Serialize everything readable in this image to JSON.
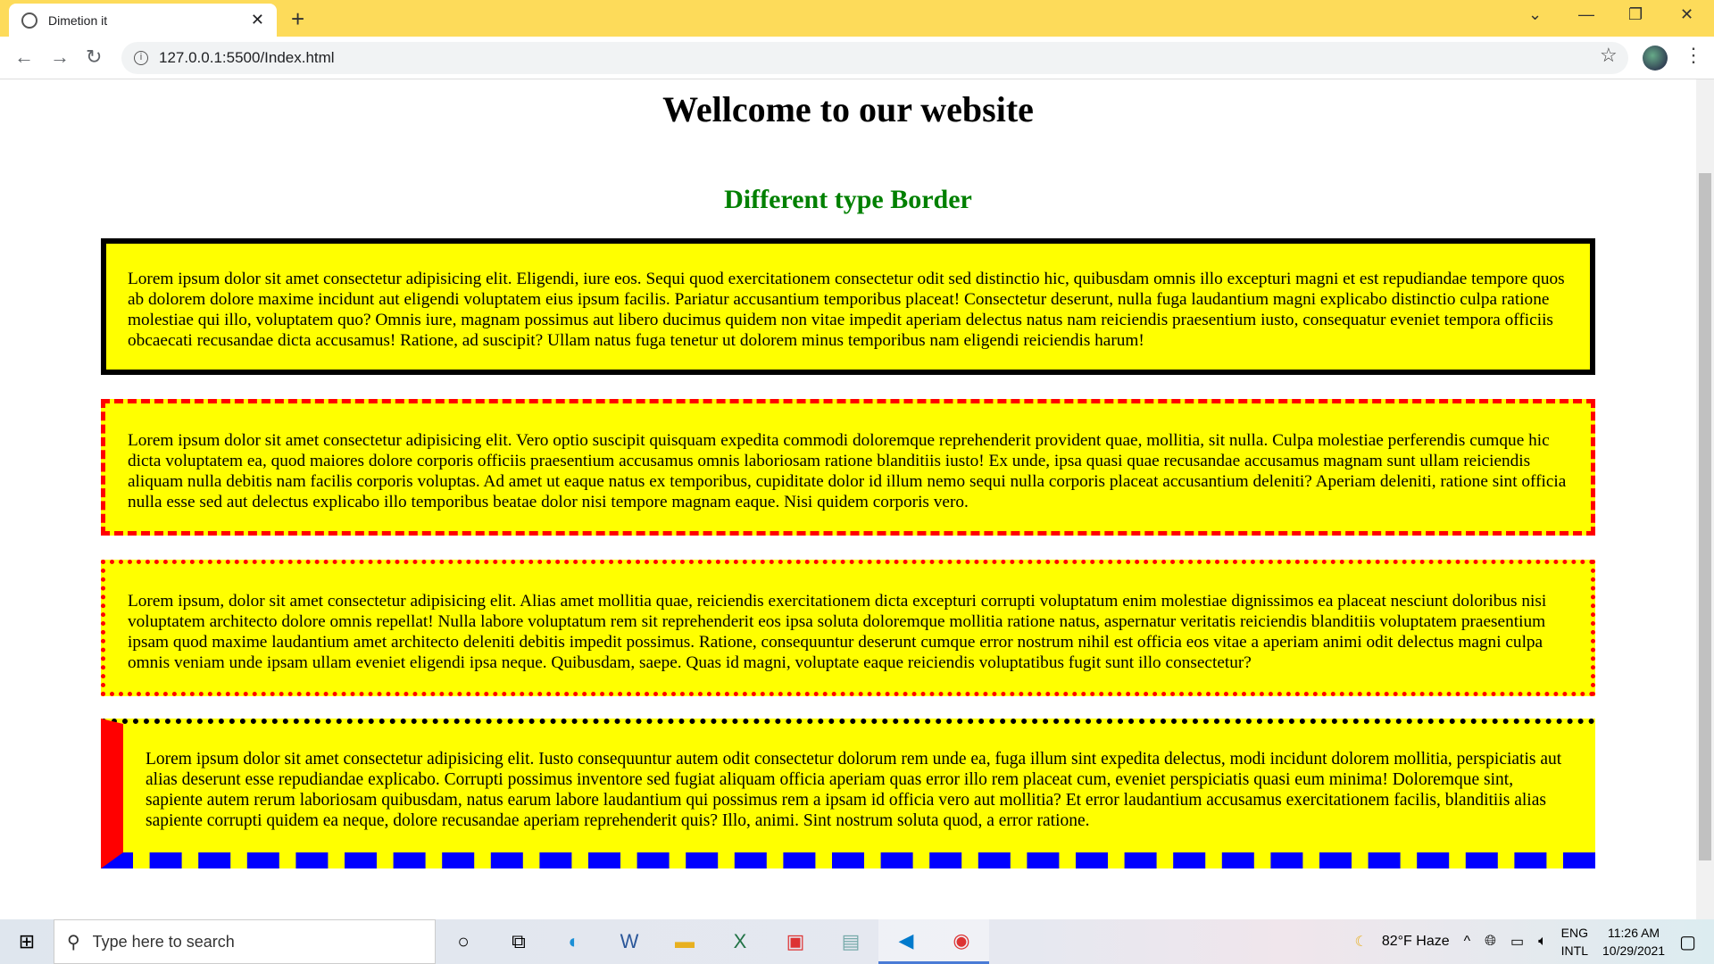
{
  "browser": {
    "tab_title": "Dimetion it",
    "url": "127.0.0.1:5500/Index.html",
    "accent": "#fddb5a"
  },
  "page": {
    "title": "Wellcome to our website",
    "subtitle": "Different type Border",
    "paragraphs": [
      "Lorem ipsum dolor sit amet consectetur adipisicing elit. Eligendi, iure eos. Sequi quod exercitationem consectetur odit sed distinctio hic, quibusdam omnis illo excepturi magni et est repudiandae tempore quos ab dolorem dolore maxime incidunt aut eligendi voluptatem eius ipsum facilis. Pariatur accusantium temporibus placeat! Consectetur deserunt, nulla fuga laudantium magni explicabo distinctio culpa ratione molestiae qui illo, voluptatem quo? Omnis iure, magnam possimus aut libero ducimus quidem non vitae impedit aperiam delectus natus nam reiciendis praesentium iusto, consequatur eveniet tempora officiis obcaecati recusandae dicta accusamus! Ratione, ad suscipit? Ullam natus fuga tenetur ut dolorem minus temporibus nam eligendi reiciendis harum!",
      "Lorem ipsum dolor sit amet consectetur adipisicing elit. Vero optio suscipit quisquam expedita commodi doloremque reprehenderit provident quae, mollitia, sit nulla. Culpa molestiae perferendis cumque hic dicta voluptatem ea, quod maiores dolore corporis officiis praesentium accusamus omnis laboriosam ratione blanditiis iusto! Ex unde, ipsa quasi quae recusandae accusamus magnam sunt ullam reiciendis aliquam nulla debitis nam facilis corporis voluptas. Ad amet ut eaque natus ex temporibus, cupiditate dolor id illum nemo sequi nulla corporis placeat accusantium deleniti? Aperiam deleniti, ratione sint officia nulla esse sed aut delectus explicabo illo temporibus beatae dolor nisi tempore magnam eaque. Nisi quidem corporis vero.",
      "Lorem ipsum, dolor sit amet consectetur adipisicing elit. Alias amet mollitia quae, reiciendis exercitationem dicta excepturi corrupti voluptatum enim molestiae dignissimos ea placeat nesciunt doloribus nisi voluptatem architecto dolore omnis repellat! Nulla labore voluptatum rem sit reprehenderit eos ipsa soluta doloremque mollitia ratione natus, aspernatur veritatis reiciendis blanditiis voluptatem praesentium ipsam quod maxime laudantium amet architecto deleniti debitis impedit possimus. Ratione, consequuntur deserunt cumque error nostrum nihil est officia eos vitae a aperiam animi odit delectus magni culpa omnis veniam unde ipsam ullam eveniet eligendi ipsa neque. Quibusdam, saepe. Quas id magni, voluptate eaque reiciendis voluptatibus fugit sunt illo consectetur?",
      "Lorem ipsum dolor sit amet consectetur adipisicing elit. Iusto consequuntur autem odit consectetur dolorum rem unde ea, fuga illum sint expedita delectus, modi incidunt dolorem mollitia, perspiciatis aut alias deserunt esse repudiandae explicabo. Corrupti possimus inventore sed fugiat aliquam officia aperiam quas error illo rem placeat cum, eveniet perspiciatis quasi eum minima! Doloremque sint, sapiente autem rerum laboriosam quibusdam, natus earum labore laudantium qui possimus rem a ipsam id officia vero aut mollitia? Et error laudantium accusamus exercitationem facilis, blanditiis alias sapiente corrupti quidem ea neque, dolore recusandae aperiam reprehenderit quis? Illo, animi. Sint nostrum soluta quod, a error ratione."
    ],
    "colors": {
      "box_bg": "#ffff00",
      "subtitle": "#008000",
      "red": "#ff0000",
      "blue": "#0000ff"
    }
  },
  "taskbar": {
    "search_placeholder": "Type here to search",
    "weather": "82°F  Haze",
    "lang1": "ENG",
    "lang2": "INTL",
    "time": "11:26 AM",
    "date": "10/29/2021"
  }
}
